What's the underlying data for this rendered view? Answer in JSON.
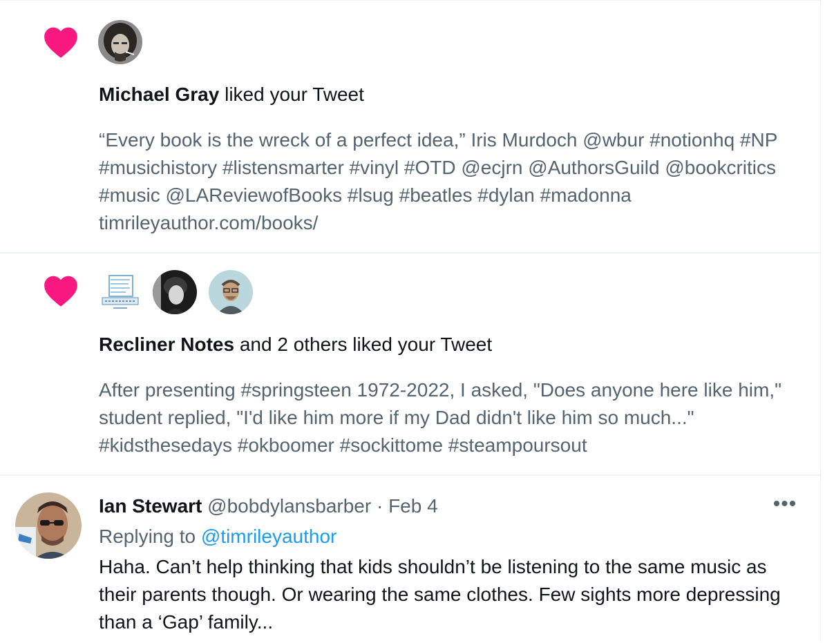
{
  "colors": {
    "heart": "#f91880",
    "link": "#1d9bf0",
    "muted": "#536471",
    "text": "#0f1419"
  },
  "notifications": [
    {
      "icon": "heart-icon",
      "avatars": [
        "avatar-michael-gray"
      ],
      "actor": "Michael Gray",
      "action": " liked your Tweet",
      "text": "“Every book is the wreck of a perfect idea,” Iris Murdoch @wbur #notionhq #NP #musichistory #listensmarter #vinyl #OTD @ecjrn @AuthorsGuild @bookcritics #music @LAReviewofBooks #lsug #beatles #dylan #madonna timrileyauthor.com/books/"
    },
    {
      "icon": "heart-icon",
      "avatars": [
        "avatar-recliner-notes",
        "avatar-user-2",
        "avatar-user-3"
      ],
      "actor": "Recliner Notes",
      "action": " and 2 others liked your Tweet",
      "text": "After presenting #springsteen 1972-2022, I asked, \"Does anyone here like him,\" student replied, \"I'd like him more if my Dad didn't like him so much...\" #kidsthesedays #okboomer #sockittome #steampoursout"
    }
  ],
  "reply": {
    "name": "Ian Stewart",
    "handle": "@bobdylansbarber",
    "separator": " · ",
    "date": "Feb 4",
    "replying_prefix": "Replying to ",
    "replying_to": "@timrileyauthor",
    "text": "Haha. Can’t help thinking that kids shouldn’t be listening to the same music as their parents though. Or wearing the same clothes. Few sights more depressing than a ‘Gap’ family...",
    "more_label": "•••"
  }
}
